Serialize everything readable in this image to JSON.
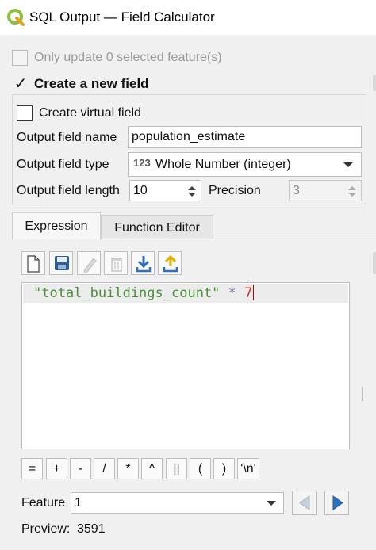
{
  "window": {
    "title": "SQL Output — Field Calculator",
    "app_icon": "qgis-logo-icon"
  },
  "update_selected": {
    "label": "Only update 0 selected feature(s)",
    "checked": false,
    "enabled": false
  },
  "new_field": {
    "group_label": "Create a new field",
    "group_checked": true,
    "check_glyph": "✓",
    "virtual_label": "Create virtual field",
    "virtual_checked": false,
    "name_label": "Output field name",
    "name_value": "population_estimate",
    "type_label": "Output field type",
    "type_badge": "123",
    "type_value": "Whole Number (integer)",
    "length_label": "Output field length",
    "length_value": "10",
    "precision_label": "Precision",
    "precision_value": "3"
  },
  "tabs": [
    {
      "label": "Expression",
      "active": true
    },
    {
      "label": "Function Editor",
      "active": false
    }
  ],
  "toolbar": [
    {
      "name": "new-file-icon",
      "enabled": true
    },
    {
      "name": "save-icon",
      "enabled": true
    },
    {
      "name": "edit-icon",
      "enabled": false
    },
    {
      "name": "delete-icon",
      "enabled": false
    },
    {
      "name": "import-icon",
      "enabled": true
    },
    {
      "name": "export-icon",
      "enabled": true
    }
  ],
  "expression": {
    "string_part": "\"total_buildings_count\"",
    "operator_part": "*",
    "number_part": "7"
  },
  "operators": [
    "=",
    "+",
    "-",
    "/",
    "*",
    "^",
    "||",
    "(",
    ")",
    "'\\n'"
  ],
  "feature": {
    "label": "Feature",
    "value": "1"
  },
  "preview": {
    "label": "Preview:",
    "value": "3591"
  },
  "colors": {
    "accent_check": "#000000",
    "string_color": "#4b8f3b",
    "number_color": "#c0392b",
    "nav_arrow": "#2d6fc0"
  }
}
